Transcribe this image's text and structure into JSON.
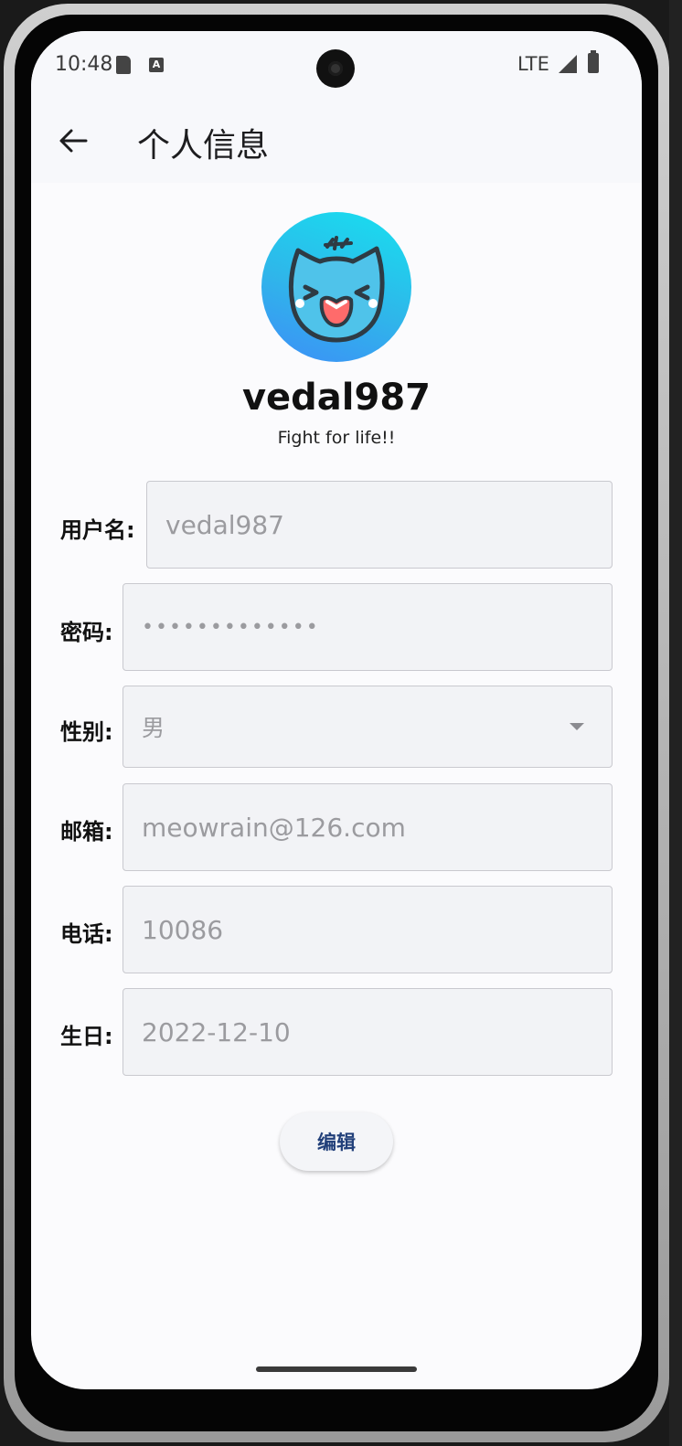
{
  "status_bar": {
    "time": "10:48",
    "network": "LTE"
  },
  "app_bar": {
    "title": "个人信息",
    "back_icon": "arrow-left-icon"
  },
  "profile": {
    "avatar_icon": "cat-avatar-icon",
    "display_name": "vedal987",
    "motto": "Fight for life!!"
  },
  "form": {
    "username": {
      "label": "用户名:",
      "value": "vedal987"
    },
    "password": {
      "label": "密码:",
      "value": "•••••••••••••"
    },
    "gender": {
      "label": "性别:",
      "value": "男"
    },
    "email": {
      "label": "邮箱:",
      "value": "meowrain@126.com"
    },
    "phone": {
      "label": "电话:",
      "value": "10086"
    },
    "birthday": {
      "label": "生日:",
      "value": "2022-12-10"
    }
  },
  "actions": {
    "edit_label": "编辑"
  },
  "colors": {
    "background": "#fbfbfd",
    "field_bg": "#f2f3f6",
    "field_border": "#c9c9cf",
    "button_text": "#22407a"
  }
}
